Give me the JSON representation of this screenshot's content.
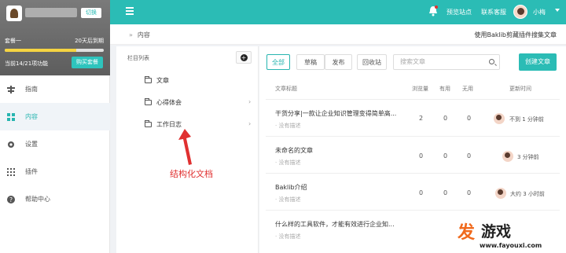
{
  "account": {
    "switch_label": "切换",
    "plan_name": "套餐一",
    "expiry": "20天后到期",
    "usage_progress": 0.72,
    "features_used": "当前14/21项功能",
    "buy_label": "购买套餐"
  },
  "nav": {
    "items": [
      {
        "label": "指南",
        "icon": "guide-icon"
      },
      {
        "label": "内容",
        "icon": "grid-icon"
      },
      {
        "label": "设置",
        "icon": "gear-icon"
      },
      {
        "label": "插件",
        "icon": "apps-icon"
      },
      {
        "label": "帮助中心",
        "icon": "help-icon"
      }
    ],
    "active_index": 1
  },
  "topbar": {
    "preview_link": "预览站点",
    "contact_link": "联系客服",
    "username": "小梅"
  },
  "breadcrumb": {
    "current": "内容",
    "import_link": "使用Baklib剪藏插件搜集文章"
  },
  "tree": {
    "header": "栏目列表",
    "items": [
      {
        "label": "文章",
        "has_children": false
      },
      {
        "label": "心得体会",
        "has_children": true
      },
      {
        "label": "工作日志",
        "has_children": true
      }
    ]
  },
  "annotation": "结构化文档",
  "list": {
    "tabs": [
      "全部",
      "草稿",
      "发布",
      "回收站"
    ],
    "search_placeholder": "搜索文章",
    "create_label": "创建文章",
    "columns": {
      "title": "文章标题",
      "views": "浏览量",
      "useful": "有用",
      "useless": "无用",
      "updated": "更新时间"
    },
    "rows": [
      {
        "title": "干货分享|一款让企业知识管理变得简单高...",
        "desc": "· 没有描述",
        "views": "2",
        "useful": "0",
        "useless": "0",
        "updated": "不到 1 分钟前"
      },
      {
        "title": "未命名的文章",
        "desc": "· 没有描述",
        "views": "0",
        "useful": "0",
        "useless": "0",
        "updated": "3 分钟前"
      },
      {
        "title": "Baklib介绍",
        "desc": "· 没有描述",
        "views": "0",
        "useful": "0",
        "useless": "0",
        "updated": "大约 3 小时前"
      },
      {
        "title": "什么样的工具软件，才能有效进行企业知...",
        "desc": "· 没有描述",
        "views": "",
        "useful": "",
        "useless": "",
        "updated": ""
      }
    ]
  },
  "watermark": {
    "logo": "发",
    "name": "游戏",
    "url": "www.fayouxi.com"
  },
  "colors": {
    "accent": "#2bbcb5",
    "annotation": "#e03030",
    "watermark": "#f06a1d"
  }
}
